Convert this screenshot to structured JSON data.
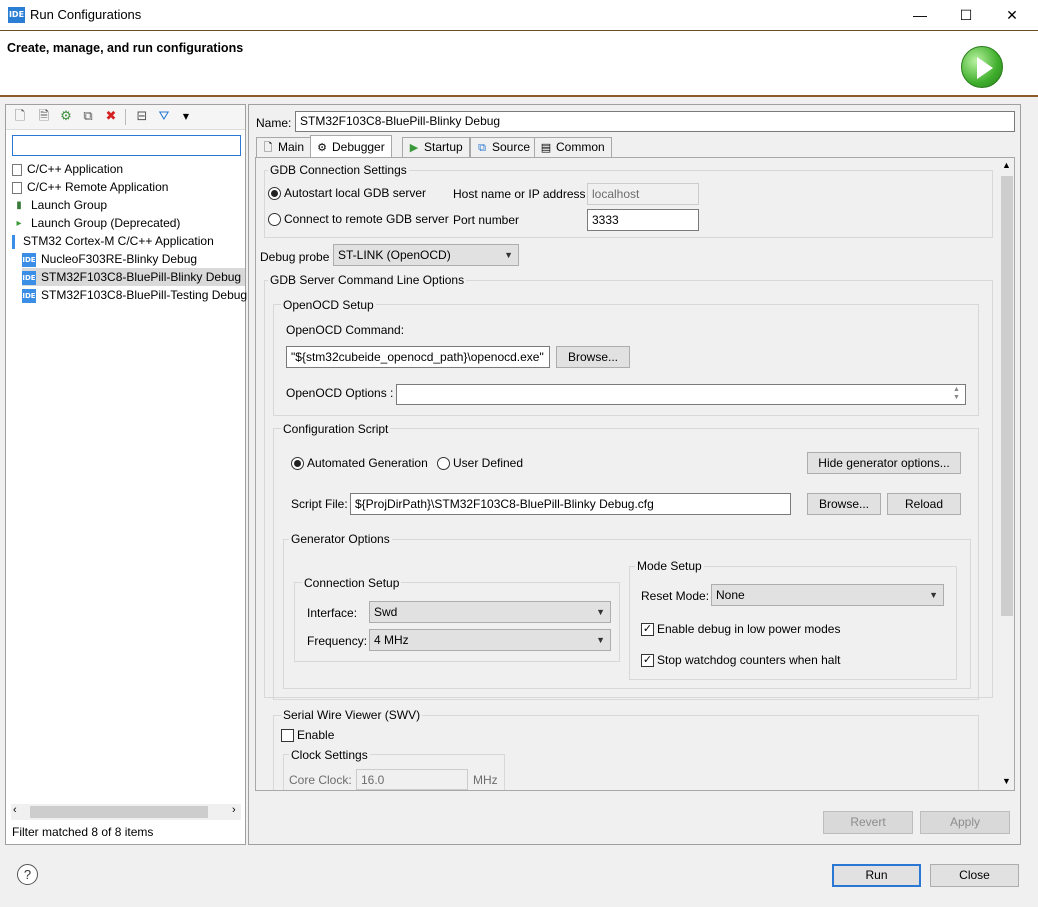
{
  "window": {
    "title": "Run Configurations",
    "app_badge": "IDE",
    "minimize": "—",
    "maximize": "☐",
    "close": "✕"
  },
  "banner": {
    "title": "Create, manage, and run configurations"
  },
  "left": {
    "filter_placeholder": "",
    "tree": [
      {
        "label": "C/C++ Application",
        "icon": "c-app-icon"
      },
      {
        "label": "C/C++ Remote Application",
        "icon": "c-remote-app-icon"
      },
      {
        "label": "Launch Group",
        "icon": "launch-group-icon"
      },
      {
        "label": "Launch Group (Deprecated)",
        "icon": "launch-group-deprecated-icon"
      },
      {
        "label": "STM32 Cortex-M C/C++ Application",
        "icon": "stm32-ide-icon"
      },
      {
        "label": "NucleoF303RE-Blinky Debug",
        "icon": "ide-icon"
      },
      {
        "label": "STM32F103C8-BluePill-Blinky Debug",
        "icon": "ide-icon",
        "selected": true
      },
      {
        "label": "STM32F103C8-BluePill-Testing Debug",
        "icon": "ide-icon"
      }
    ],
    "status": "Filter matched 8 of 8 items"
  },
  "right": {
    "name_label": "Name:",
    "name_value": "STM32F103C8-BluePill-Blinky Debug",
    "tabs": [
      "Main",
      "Debugger",
      "Startup",
      "Source",
      "Common"
    ],
    "active_tab": "Debugger",
    "gdb": {
      "group": "GDB Connection Settings",
      "autostart": "Autostart local GDB server",
      "remote": "Connect to remote GDB server",
      "host_label": "Host name or IP address",
      "host_value": "localhost",
      "port_label": "Port number",
      "port_value": "3333"
    },
    "probe": {
      "label": "Debug probe",
      "value": "ST-LINK (OpenOCD)"
    },
    "server": {
      "group": "GDB Server Command Line Options",
      "openocd_group": "OpenOCD Setup",
      "command_label": "OpenOCD Command:",
      "command_value": "\"${stm32cubeide_openocd_path}\\openocd.exe\"",
      "browse": "Browse...",
      "options_label": "OpenOCD Options :",
      "options_value": ""
    },
    "script": {
      "group": "Configuration Script",
      "automated": "Automated Generation",
      "user_defined": "User Defined",
      "hide_btn": "Hide generator options...",
      "file_label": "Script File:",
      "file_value": "${ProjDirPath}\\STM32F103C8-BluePill-Blinky Debug.cfg",
      "browse": "Browse...",
      "reload": "Reload"
    },
    "generator": {
      "group": "Generator Options",
      "connection_group": "Connection Setup",
      "interface_label": "Interface:",
      "interface_value": "Swd",
      "frequency_label": "Frequency:",
      "frequency_value": "4 MHz",
      "mode_group": "Mode Setup",
      "reset_label": "Reset Mode:",
      "reset_value": "None",
      "low_power": "Enable debug in low power modes",
      "watchdog": "Stop watchdog counters when halt"
    },
    "swv": {
      "group": "Serial Wire Viewer (SWV)",
      "enable": "Enable",
      "clock_group": "Clock Settings",
      "core_clock_label": "Core Clock:",
      "core_clock_value": "16.0",
      "unit": "MHz"
    },
    "revert": "Revert",
    "apply": "Apply"
  },
  "footer": {
    "help": "?",
    "run": "Run",
    "close": "Close"
  },
  "colors": {
    "accent": "#2a78d4",
    "banner_border": "#8a5a28",
    "run_green": "#3fae2c"
  }
}
